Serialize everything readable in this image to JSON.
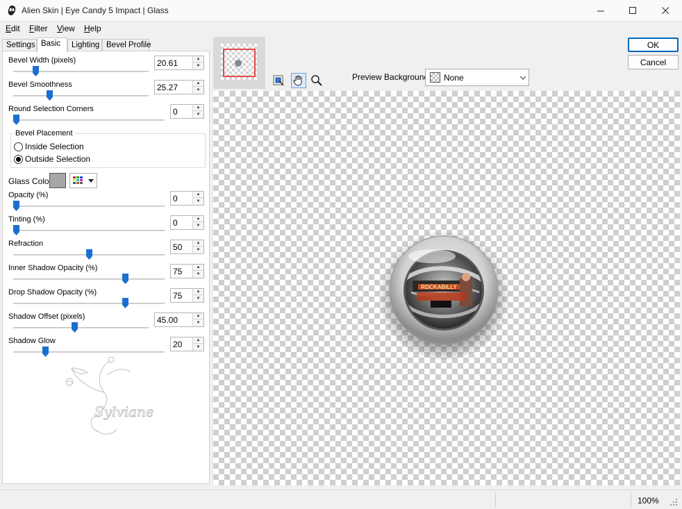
{
  "window": {
    "title": "Alien Skin | Eye Candy 5 Impact | Glass",
    "controls": [
      "—",
      "☐",
      "✕"
    ]
  },
  "menu": [
    {
      "label": "Edit",
      "accel": "E",
      "rest": "dit"
    },
    {
      "label": "Filter",
      "accel": "F",
      "rest": "ilter"
    },
    {
      "label": "View",
      "accel": "V",
      "rest": "iew"
    },
    {
      "label": "Help",
      "accel": "H",
      "rest": "elp"
    }
  ],
  "tabs": [
    "Settings",
    "Basic",
    "Lighting",
    "Bevel Profile"
  ],
  "active_tab": "Basic",
  "controls": {
    "bevel_width": {
      "label": "Bevel Width (pixels)",
      "value": "20.61",
      "level": 0.15
    },
    "bevel_smoothness": {
      "label": "Bevel Smoothness",
      "value": "25.27",
      "level": 0.26
    },
    "round_corners": {
      "label": "Round Selection Corners",
      "value": "0",
      "level": 0.0
    },
    "bevel_placement": {
      "title": "Bevel Placement",
      "options": [
        "Inside Selection",
        "Outside Selection"
      ],
      "selected": "Outside Selection"
    },
    "glass_color": {
      "label": "Glass Color",
      "swatch": "#a6a6a6"
    },
    "opacity": {
      "label": "Opacity (%)",
      "value": "0",
      "level": 0.0
    },
    "tinting": {
      "label": "Tinting (%)",
      "value": "0",
      "level": 0.0
    },
    "refraction": {
      "label": "Refraction",
      "value": "50",
      "level": 0.5
    },
    "inner_shadow_opacity": {
      "label": "Inner Shadow Opacity (%)",
      "value": "75",
      "level": 0.75
    },
    "drop_shadow_opacity": {
      "label": "Drop Shadow Opacity (%)",
      "value": "75",
      "level": 0.75
    },
    "shadow_offset": {
      "label": "Shadow Offset (pixels)",
      "value": "45.00",
      "level": 0.45
    },
    "shadow_glow": {
      "label": "Shadow Glow",
      "value": "20",
      "level": 0.2
    }
  },
  "watermark": {
    "text": "Sylviane"
  },
  "toolbar": {
    "tools": [
      "navigator-icon",
      "hand-icon",
      "zoom-icon"
    ],
    "active_tool": "hand-icon"
  },
  "preview_background": {
    "label": "Preview Background:",
    "value": "None"
  },
  "buttons": {
    "ok": "OK",
    "cancel": "Cancel"
  },
  "preview_image": {
    "banner_text": "ROCKABILLY"
  },
  "status": {
    "zoom": "100%"
  },
  "colors": {
    "accent": "#0067c0",
    "slider_thumb": "#1a6fd0",
    "nav_rect": "#e34a4a"
  }
}
